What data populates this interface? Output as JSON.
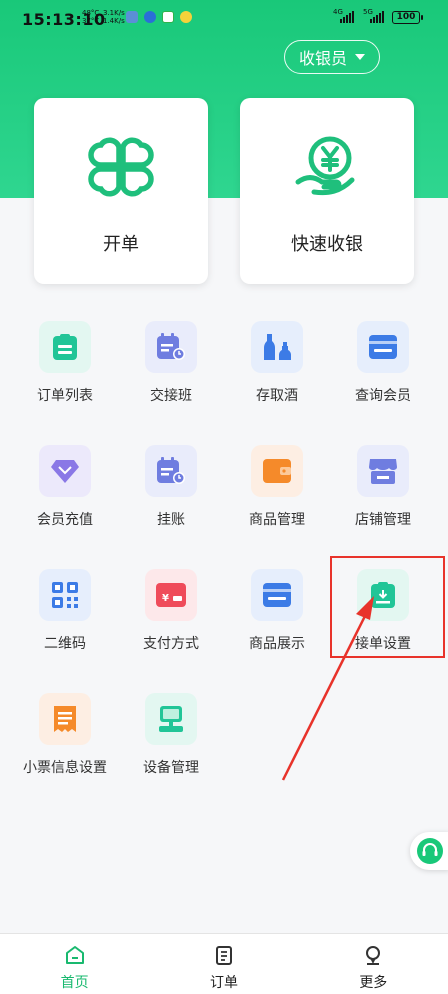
{
  "status_bar": {
    "time": "15:13:10",
    "temp_top": "48°C",
    "temp_bottom": "37°C",
    "speed_top": "3.1K/s",
    "speed_bottom": "1.4K/s",
    "net1": "4G",
    "net2": "5G",
    "battery": "100"
  },
  "header": {
    "role_label": "收银员"
  },
  "main_actions": [
    {
      "label": "开单"
    },
    {
      "label": "快速收银"
    }
  ],
  "grid": [
    {
      "label": "订单列表",
      "icon": "clipboard-icon",
      "tile_color": "#e3f7f1",
      "icon_color": "#21c597"
    },
    {
      "label": "交接班",
      "icon": "shift-calendar-icon",
      "tile_color": "#e9ecfb",
      "icon_color": "#6f7de0"
    },
    {
      "label": "存取酒",
      "icon": "wine-bottle-icon",
      "tile_color": "#e6eefc",
      "icon_color": "#3c7be6"
    },
    {
      "label": "查询会员",
      "icon": "member-card-icon",
      "tile_color": "#e6eefc",
      "icon_color": "#3c7be6"
    },
    {
      "label": "会员充值",
      "icon": "diamond-icon",
      "tile_color": "#ece9fb",
      "icon_color": "#8a78e6"
    },
    {
      "label": "挂账",
      "icon": "credit-ledger-icon",
      "tile_color": "#e9ecfb",
      "icon_color": "#6f7de0"
    },
    {
      "label": "商品管理",
      "icon": "wallet-icon",
      "tile_color": "#fdeee3",
      "icon_color": "#f58a2a"
    },
    {
      "label": "店铺管理",
      "icon": "store-icon",
      "tile_color": "#e9ecfb",
      "icon_color": "#6f7de0"
    },
    {
      "label": "二维码",
      "icon": "qr-code-icon",
      "tile_color": "#e6eefc",
      "icon_color": "#3c7be6"
    },
    {
      "label": "支付方式",
      "icon": "payment-card-icon",
      "tile_color": "#fde8ea",
      "icon_color": "#ef4b5a"
    },
    {
      "label": "商品展示",
      "icon": "display-card-icon",
      "tile_color": "#e6eefc",
      "icon_color": "#3c7be6"
    },
    {
      "label": "接单设置",
      "icon": "order-receive-icon",
      "tile_color": "#e3f7f1",
      "icon_color": "#21c597"
    },
    {
      "label": "小票信息设置",
      "icon": "receipt-icon",
      "tile_color": "#fdeee3",
      "icon_color": "#f58a2a"
    },
    {
      "label": "设备管理",
      "icon": "pos-device-icon",
      "tile_color": "#e3f7f1",
      "icon_color": "#21c597"
    }
  ],
  "bottom_nav": [
    {
      "label": "首页",
      "icon": "home-icon",
      "active": true
    },
    {
      "label": "订单",
      "icon": "order-list-icon",
      "active": false
    },
    {
      "label": "更多",
      "icon": "more-profile-icon",
      "active": false
    }
  ],
  "colors": {
    "brand": "#19c879",
    "highlight": "#e8332b"
  }
}
